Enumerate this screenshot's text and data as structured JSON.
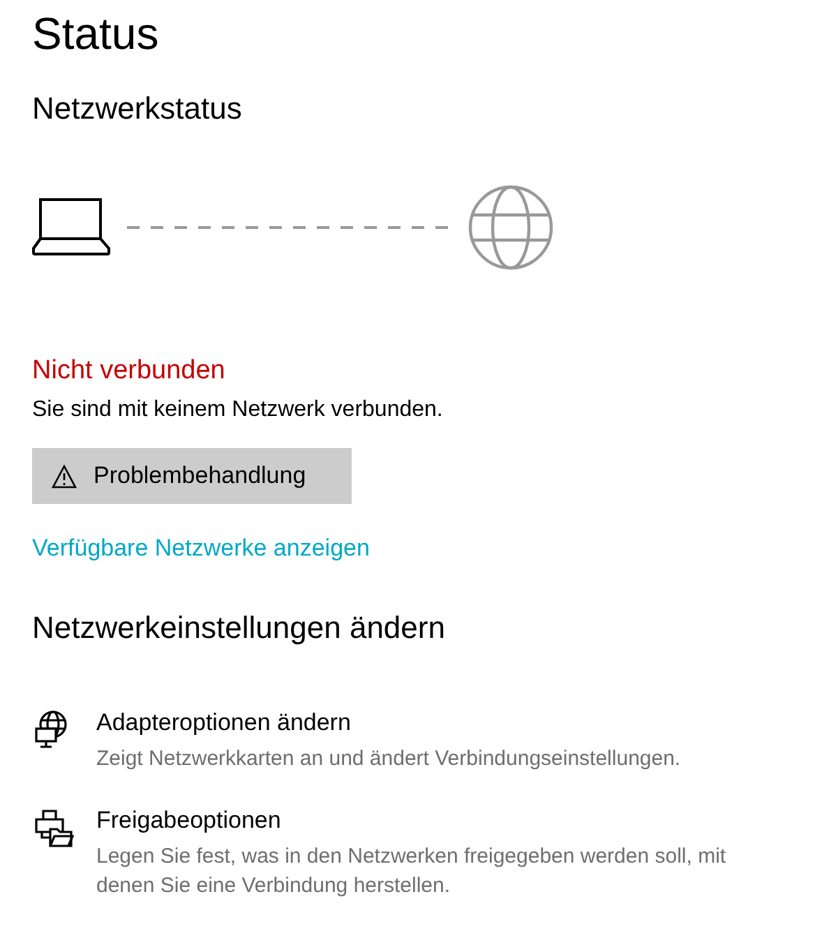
{
  "page_title": "Status",
  "network_status": {
    "heading": "Netzwerkstatus",
    "connected": false,
    "state_label": "Nicht verbunden",
    "description": "Sie sind mit keinem Netzwerk verbunden.",
    "troubleshoot_button": "Problembehandlung",
    "link": "Verfügbare Netzwerke anzeigen"
  },
  "settings": {
    "heading": "Netzwerkeinstellungen ändern",
    "items": [
      {
        "kind": "adapter",
        "title": "Adapteroptionen ändern",
        "description": "Zeigt Netzwerkkarten an und ändert Verbindungseinstellungen."
      },
      {
        "kind": "sharing",
        "title": "Freigabeoptionen",
        "description": "Legen Sie fest, was in den Netzwerken freigegeben werden soll, mit denen Sie eine Verbindung herstellen."
      }
    ]
  }
}
